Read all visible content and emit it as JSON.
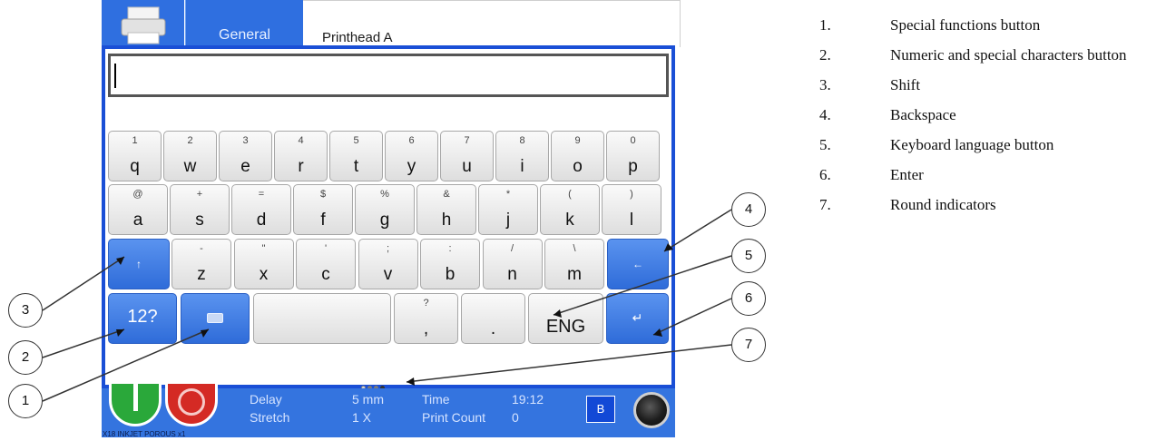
{
  "tabs": {
    "general": "General",
    "printhead": "Printhead A"
  },
  "input": {
    "value": ""
  },
  "keyboard": {
    "row1": [
      {
        "hint": "1",
        "key": "q"
      },
      {
        "hint": "2",
        "key": "w"
      },
      {
        "hint": "3",
        "key": "e"
      },
      {
        "hint": "4",
        "key": "r"
      },
      {
        "hint": "5",
        "key": "t"
      },
      {
        "hint": "6",
        "key": "y"
      },
      {
        "hint": "7",
        "key": "u"
      },
      {
        "hint": "8",
        "key": "i"
      },
      {
        "hint": "9",
        "key": "o"
      },
      {
        "hint": "0",
        "key": "p"
      }
    ],
    "row2": [
      {
        "hint": "@",
        "key": "a"
      },
      {
        "hint": "+",
        "key": "s"
      },
      {
        "hint": "=",
        "key": "d"
      },
      {
        "hint": "$",
        "key": "f"
      },
      {
        "hint": "%",
        "key": "g"
      },
      {
        "hint": "&",
        "key": "h"
      },
      {
        "hint": "*",
        "key": "j"
      },
      {
        "hint": "(",
        "key": "k"
      },
      {
        "hint": ")",
        "key": "l"
      }
    ],
    "row3": [
      {
        "hint": "-",
        "key": "z"
      },
      {
        "hint": "\"",
        "key": "x"
      },
      {
        "hint": "'",
        "key": "c"
      },
      {
        "hint": ";",
        "key": "v"
      },
      {
        "hint": ":",
        "key": "b"
      },
      {
        "hint": "/",
        "key": "n"
      },
      {
        "hint": "\\",
        "key": "m"
      }
    ],
    "numeric_label": "12?",
    "comma": {
      "hint": "?",
      "key": ","
    },
    "period": {
      "key": "."
    },
    "language_label": "ENG",
    "shift_icon": "shift-arrow-icon",
    "backspace_icon": "backspace-arrow-icon",
    "enter_icon": "enter-arrow-icon",
    "special_icon": "keyboard-icon"
  },
  "status": {
    "delay_label": "Delay",
    "delay_value": "5 mm",
    "stretch_label": "Stretch",
    "stretch_value": "1 X",
    "time_label": "Time",
    "time_value": "19:12",
    "count_label": "Print Count",
    "count_value": "0",
    "footer": "X18 INKJET POROUS x1",
    "b_button": "B"
  },
  "callouts": [
    "1",
    "2",
    "3",
    "4",
    "5",
    "6",
    "7"
  ],
  "legend": [
    {
      "num": "1.",
      "text": "Special functions button"
    },
    {
      "num": "2.",
      "text": "Numeric and special characters button"
    },
    {
      "num": "3.",
      "text": "Shift"
    },
    {
      "num": "4.",
      "text": "Backspace"
    },
    {
      "num": "5.",
      "text": "Keyboard language button"
    },
    {
      "num": "6.",
      "text": "Enter"
    },
    {
      "num": "7.",
      "text": "Round indicators"
    }
  ],
  "colors": {
    "accent": "#2f6fe0",
    "frame": "#1a4fd6",
    "start": "#2aa83a",
    "stop": "#d42a24"
  }
}
